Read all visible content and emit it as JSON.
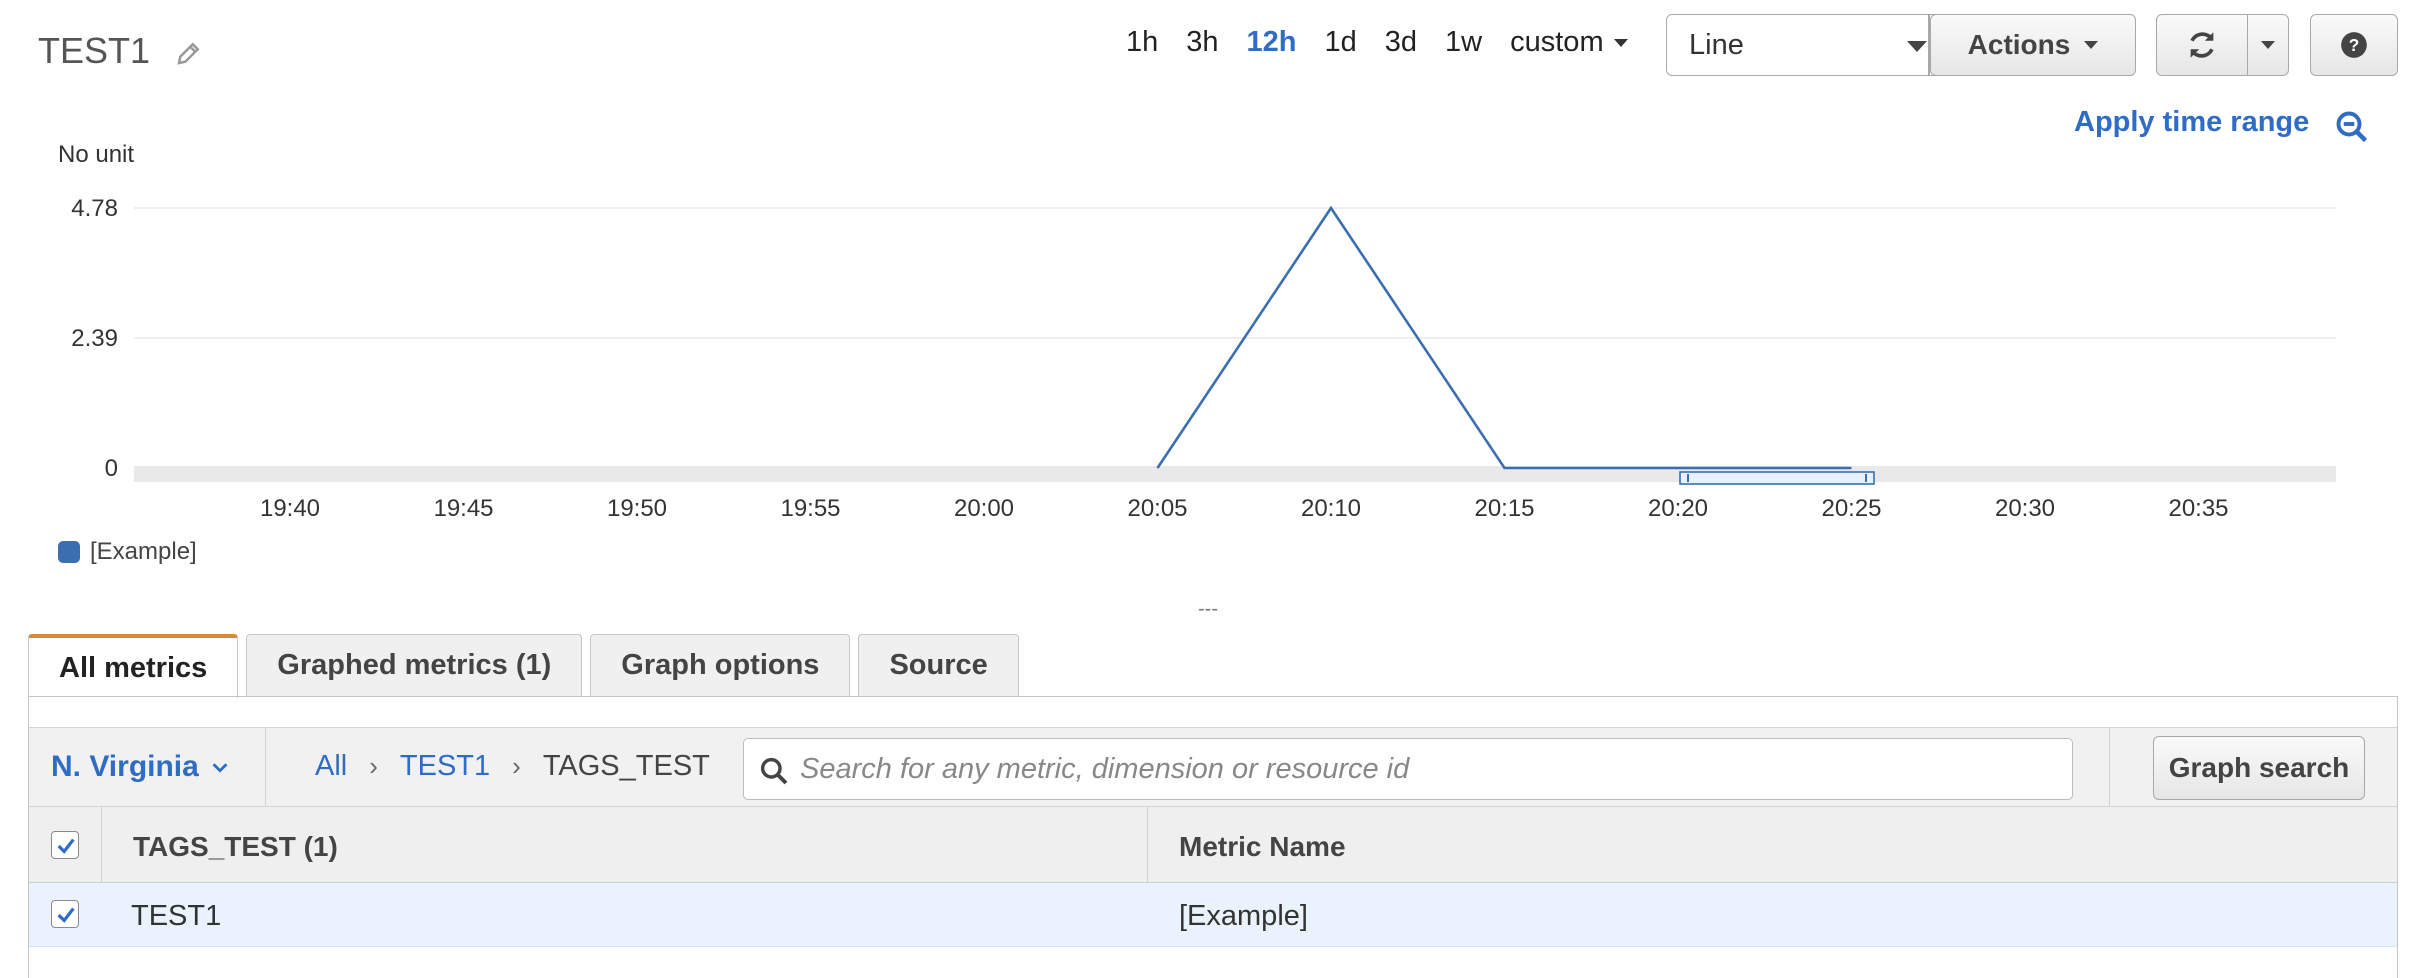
{
  "header": {
    "title": "TEST1",
    "ranges": [
      "1h",
      "3h",
      "12h",
      "1d",
      "3d",
      "1w"
    ],
    "active_range": "12h",
    "custom_label": "custom",
    "chart_type_value": "Line",
    "actions_label": "Actions",
    "apply_time_range": "Apply time range"
  },
  "chart_data": {
    "type": "line",
    "ylabel": "No unit",
    "yticks": [
      "0",
      "2.39",
      "4.78"
    ],
    "ylim": [
      0,
      4.78
    ],
    "x_tick_labels": [
      "19:40",
      "19:45",
      "19:50",
      "19:55",
      "20:00",
      "20:05",
      "20:10",
      "20:15",
      "20:20",
      "20:25",
      "20:30",
      "20:35"
    ],
    "x": [
      "20:05",
      "20:10",
      "20:15",
      "20:20",
      "20:25"
    ],
    "series": [
      {
        "name": "[Example]",
        "color": "#3b6eb0",
        "values": [
          0,
          4.78,
          0,
          0,
          0
        ]
      }
    ],
    "grid": true,
    "legend": "bottom-left"
  },
  "divider_label": "---",
  "tabs": [
    {
      "label": "All metrics",
      "active": true
    },
    {
      "label": "Graphed metrics (1)",
      "active": false
    },
    {
      "label": "Graph options",
      "active": false
    },
    {
      "label": "Source",
      "active": false
    }
  ],
  "filter": {
    "region": "N. Virginia",
    "breadcrumb": [
      "All",
      "TEST1",
      "TAGS_TEST"
    ],
    "search_placeholder": "Search for any metric, dimension or resource id",
    "graph_search_label": "Graph search"
  },
  "table": {
    "columns": [
      "TAGS_TEST  (1)",
      "Metric Name"
    ],
    "rows": [
      {
        "checked": true,
        "dimension": "TEST1",
        "metric": "[Example]"
      }
    ]
  },
  "colors": {
    "accent": "#2f6cc4",
    "series": "#3b6eb0",
    "active_tab": "#d8893b"
  }
}
